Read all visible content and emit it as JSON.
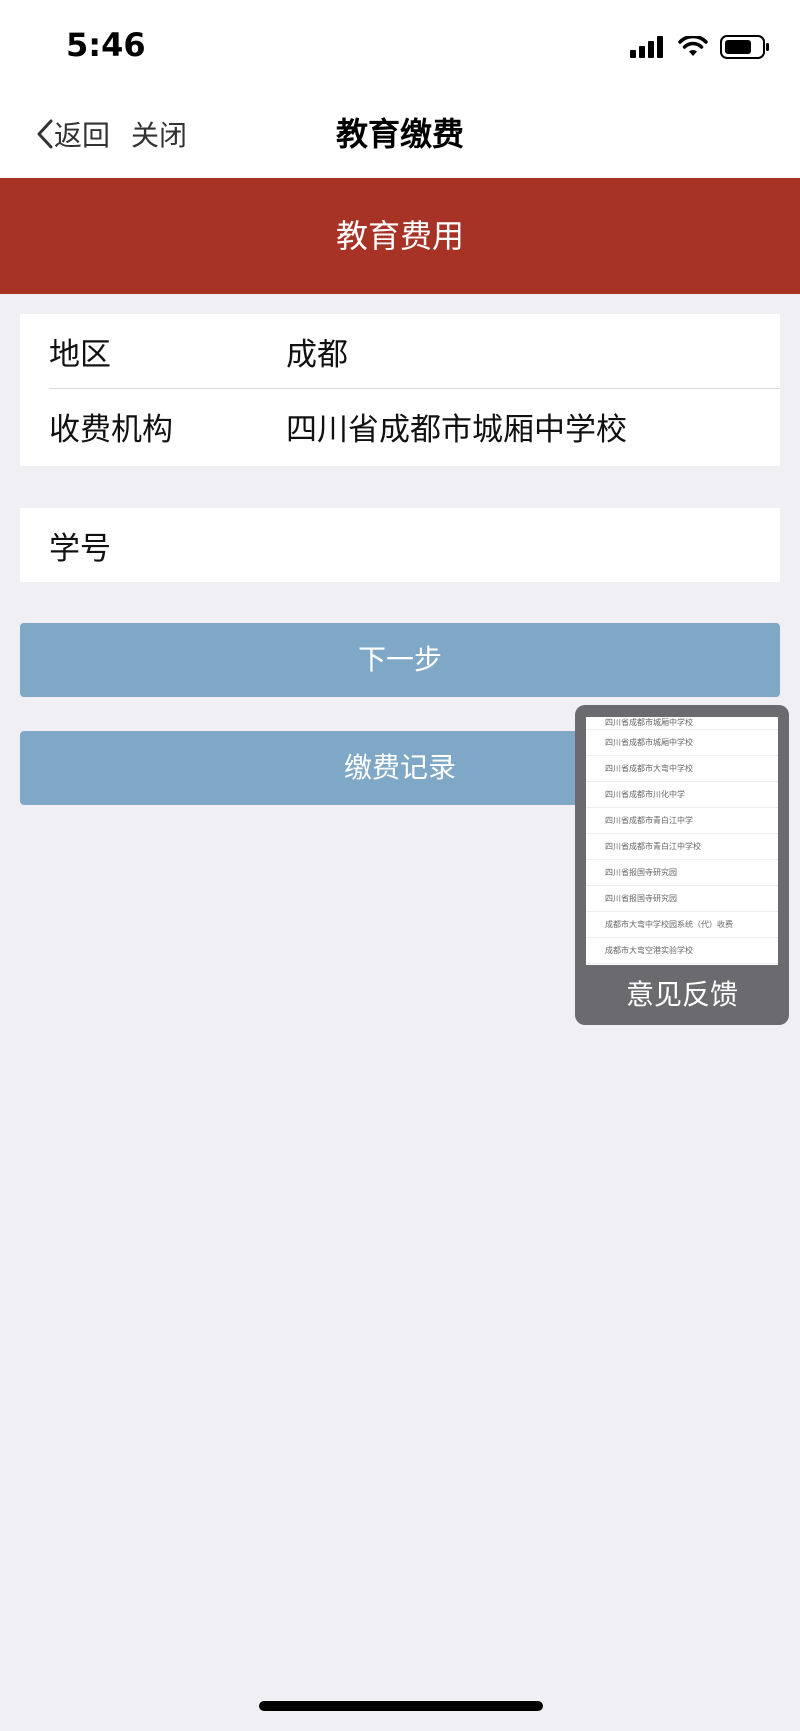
{
  "status_bar": {
    "time": "5:46"
  },
  "nav": {
    "back_label": "返回",
    "close_label": "关闭",
    "title": "教育缴费"
  },
  "banner": {
    "title": "教育费用"
  },
  "form": {
    "region_label": "地区",
    "region_value": "成都",
    "institution_label": "收费机构",
    "institution_value": "四川省成都市城厢中学校",
    "student_id_label": "学号"
  },
  "buttons": {
    "next_label": "下一步",
    "records_label": "缴费记录"
  },
  "feedback": {
    "label": "意见反馈",
    "thumbnail_items": [
      "四川省成都市城厢中学校",
      "四川省成都市城厢中学校",
      "四川省成都市大弯中学校",
      "四川省成都市川化中学",
      "四川省成都市青白江中学",
      "四川省成都市青白江中学校",
      "四川省报国寺研究园",
      "四川省报国寺研究园",
      "成都市大弯中学校园系统（代）收费",
      "成都市大弯空港实验学校"
    ]
  },
  "colors": {
    "banner": "#a73226",
    "button": "#7fa8c6",
    "background": "#efeff4"
  }
}
